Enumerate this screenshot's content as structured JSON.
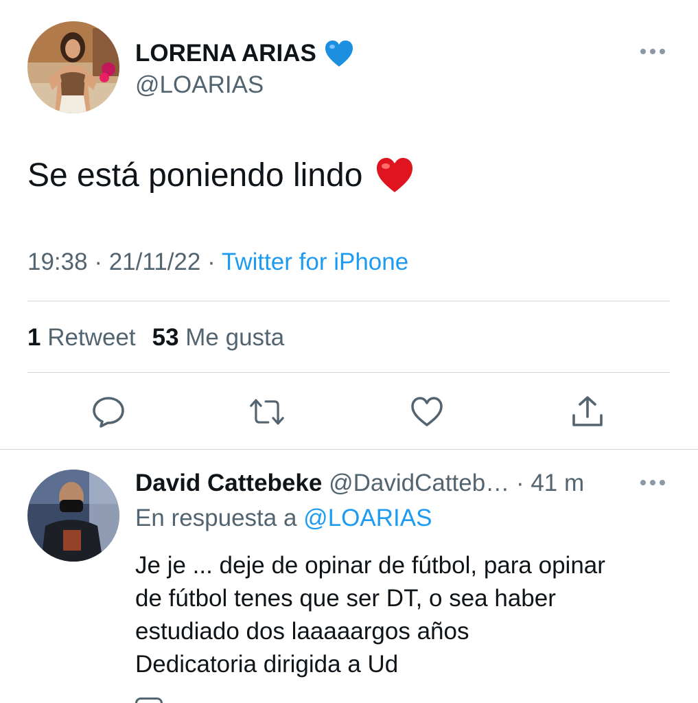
{
  "tweet": {
    "author": {
      "name": "LORENA ARIAS",
      "handle": "@LOARIAS",
      "badge_icon": "blue-heart-emoji"
    },
    "text": "Se está poniendo lindo",
    "text_emoji": "red-heart-emoji",
    "time": "19:38",
    "separator": "·",
    "date": "21/11/22",
    "source": "Twitter for iPhone",
    "stats": {
      "retweets_count": "1",
      "retweets_label": "Retweet",
      "likes_count": "53",
      "likes_label": "Me gusta"
    },
    "actions": [
      "reply-icon",
      "retweet-icon",
      "like-icon",
      "share-icon"
    ]
  },
  "reply": {
    "author_name": "David Cattebeke",
    "handle": "@DavidCatteb…",
    "separator": "·",
    "time_ago": "41 m",
    "in_reply_prefix": "En respuesta a",
    "in_reply_mention": "@LOARIAS",
    "lines": [
      "Je je ... deje de opinar de fútbol, para opinar",
      "de fútbol tenes que ser DT, o sea haber",
      "estudiado dos laaaaargos años",
      "Dedicatoria dirigida a Ud"
    ]
  },
  "colors": {
    "text": "#0f1419",
    "secondary": "#536471",
    "link": "#1d9bf0",
    "divider": "#cfd9de"
  }
}
